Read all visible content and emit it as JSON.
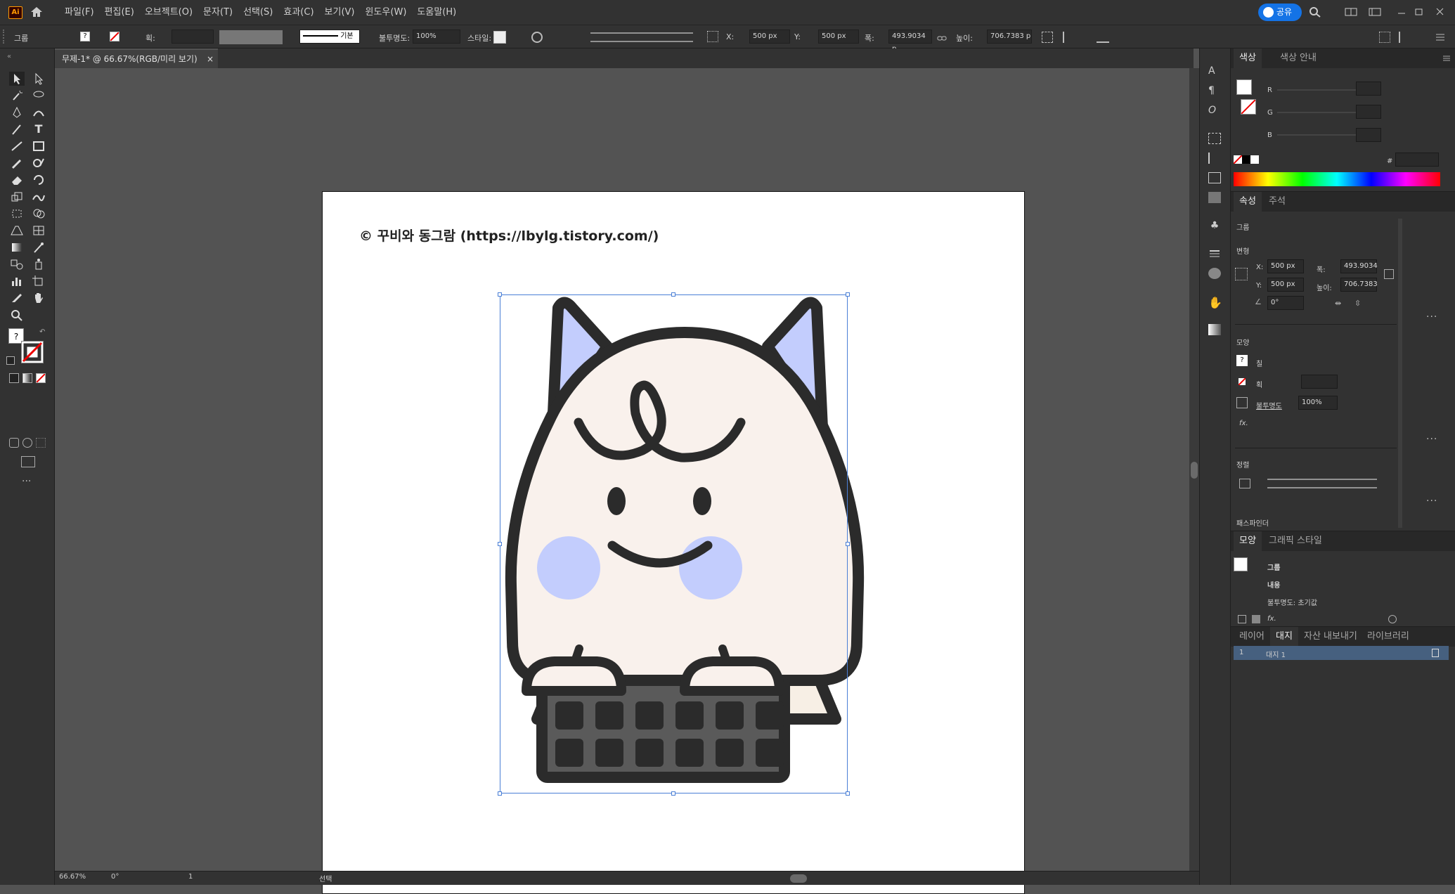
{
  "app": {
    "logo": "Ai"
  },
  "menu": [
    "파일(F)",
    "편집(E)",
    "오브젝트(O)",
    "문자(T)",
    "선택(S)",
    "효과(C)",
    "보기(V)",
    "윈도우(W)",
    "도움말(H)"
  ],
  "share": {
    "label": "공유"
  },
  "control": {
    "selection_type": "그룹",
    "stroke_label": "획:",
    "stroke_style": "기본",
    "opacity_label": "불투명도:",
    "opacity_value": "100%",
    "style_label": "스타일:",
    "x_label": "X:",
    "x_value": "500 px",
    "y_label": "Y:",
    "y_value": "500 px",
    "w_label": "폭:",
    "w_value": "493.9034 p",
    "h_label": "높이:",
    "h_value": "706.7383 p"
  },
  "document": {
    "tab_title": "무제-1* @ 66.67%(RGB/미리 보기)"
  },
  "artboard": {
    "copyright": "© 꾸비와 동그람 (https://lbylg.tistory.com/)"
  },
  "status": {
    "zoom": "66.67%",
    "rotation": "0°",
    "artboard_index": "1",
    "tool": "선택"
  },
  "color_panel": {
    "tabs": [
      "색상",
      "색상 안내"
    ],
    "r": "R",
    "g": "G",
    "b": "B",
    "hash": "#"
  },
  "properties_panel": {
    "tabs": [
      "속성",
      "주석"
    ],
    "group": "그룹",
    "transform": "변형",
    "x_label": "X:",
    "x": "500 px",
    "y_label": "Y:",
    "y": "500 px",
    "w_label": "폭:",
    "w": "493.9034",
    "h_label": "높이:",
    "h": "706.7383",
    "angle": "0°",
    "appearance": "모양",
    "fill": "칠",
    "stroke": "획",
    "opacity_label": "불투명도",
    "opacity": "100%",
    "fx": "fx.",
    "align": "정렬",
    "pathfinder": "패스파인더"
  },
  "appearance_panel": {
    "tabs": [
      "모양",
      "그래픽 스타일"
    ],
    "group": "그룹",
    "content": "내용",
    "opacity": "불투명도: 초기값",
    "fx": "fx."
  },
  "layers_panel": {
    "tabs": [
      "레이어",
      "대지",
      "자산 내보내기",
      "라이브러리"
    ],
    "row_num": "1",
    "row_name": "대지 1"
  },
  "colors": {
    "accent": "#1473e6",
    "cheek": "#c3cdfd",
    "face": "#f9f1ec",
    "outline": "#2b2b2b",
    "keyboard": "#5a5a5a"
  }
}
